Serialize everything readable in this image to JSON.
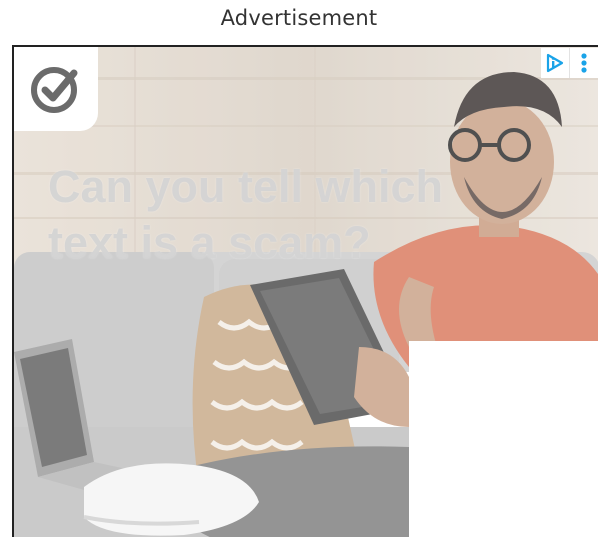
{
  "header": {
    "label": "Advertisement"
  },
  "ad": {
    "headline_line1": "Can you tell which",
    "headline_line2": "text is a scam?",
    "brand_logo": "checkmark-circle-logo",
    "adchoices_icon": "adchoices-icon",
    "menu_icon": "more-vertical-icon",
    "colors": {
      "accent": "#1aa3e8",
      "logo": "#6b6b6b",
      "shirt": "#d9785c",
      "sofa": "#c9c9c9"
    }
  }
}
